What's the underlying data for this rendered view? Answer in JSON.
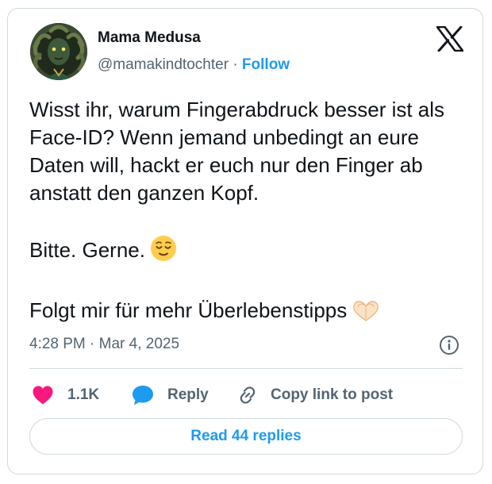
{
  "author": {
    "name": "Mama Medusa",
    "handle": "@mamakindtochter",
    "separator": "·",
    "follow_label": "Follow"
  },
  "tweet": {
    "paragraphs": [
      "Wisst ihr, warum Fingerabdruck besser ist als Face-ID? Wenn jemand unbedingt an eure Daten will, hackt er euch nur den Finger ab anstatt den ganzen Kopf.",
      "Bitte. Gerne.",
      "Folgt mir für mehr Überlebenstipps"
    ],
    "timestamp": "4:28 PM · Mar 4, 2025"
  },
  "actions": {
    "like_count": "1.1K",
    "reply_label": "Reply",
    "copy_label": "Copy link to post"
  },
  "read_replies_label": "Read 44 replies",
  "icons": {
    "logo": "x-logo-icon",
    "emoji_1": "relieved-face-emoji",
    "emoji_2": "heart-hands-emoji",
    "info": "info-icon",
    "like": "heart-icon",
    "reply": "speech-bubble-icon",
    "copy": "link-icon"
  },
  "colors": {
    "accent": "#1d9bf0",
    "like": "#f91880",
    "reply": "#1d9bf0",
    "text": "#0f1419",
    "muted": "#536471",
    "border": "#cfd9de"
  }
}
